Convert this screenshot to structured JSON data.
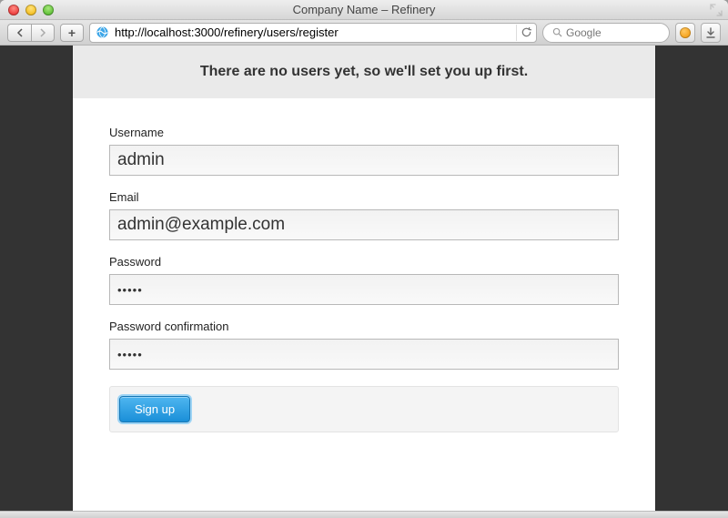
{
  "window": {
    "title": "Company Name – Refinery"
  },
  "toolbar": {
    "url": "http://localhost:3000/refinery/users/register",
    "search_placeholder": "Google"
  },
  "page": {
    "banner": "There are no users yet, so we'll set you up first.",
    "fields": {
      "username": {
        "label": "Username",
        "value": "admin"
      },
      "email": {
        "label": "Email",
        "value": "admin@example.com"
      },
      "password": {
        "label": "Password",
        "value": "•••••"
      },
      "password_confirm": {
        "label": "Password confirmation",
        "value": "•••••"
      }
    },
    "submit_label": "Sign up"
  }
}
